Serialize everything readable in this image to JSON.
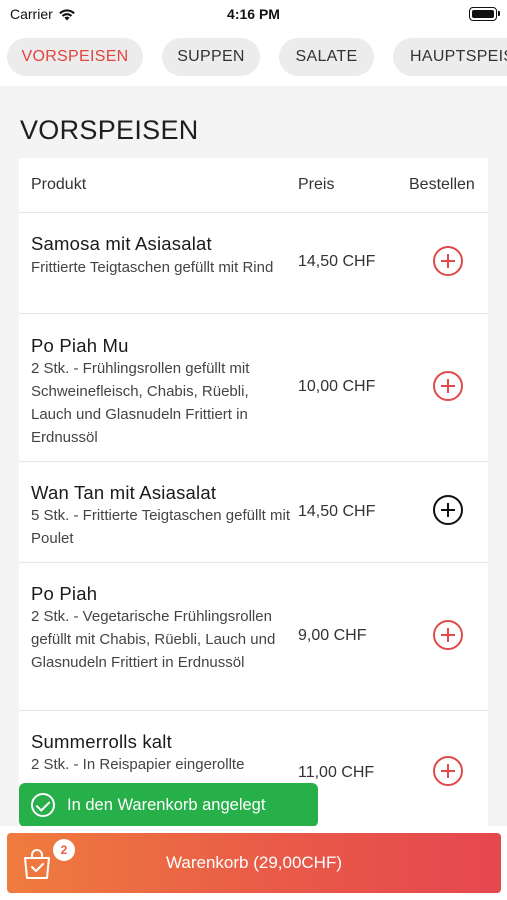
{
  "status_bar": {
    "carrier": "Carrier",
    "time": "4:16 PM"
  },
  "categories": [
    {
      "label": "VORSPEISEN",
      "active": true
    },
    {
      "label": "SUPPEN",
      "active": false
    },
    {
      "label": "SALATE",
      "active": false
    },
    {
      "label": "HAUPTSPEIS",
      "active": false
    }
  ],
  "section": {
    "title": "VORSPEISEN"
  },
  "table": {
    "columns": {
      "product": "Produkt",
      "price": "Preis",
      "order": "Bestellen"
    },
    "rows": [
      {
        "name": "Samosa mit Asiasalat",
        "description": "Frittierte Teigtaschen gefüllt mit Rind",
        "price": "14,50 CHF",
        "in_cart": false
      },
      {
        "name": "Po Piah Mu",
        "description": "2 Stk. - Frühlingsrollen gefüllt mit Schweinefleisch, Chabis, Rüebli, Lauch und Glasnudeln Frittiert in Erdnussöl",
        "price": "10,00 CHF",
        "in_cart": false
      },
      {
        "name": "Wan Tan mit Asiasalat",
        "description": "5 Stk. -  Frittierte Teigtaschen gefüllt mit Poulet",
        "price": "14,50 CHF",
        "in_cart": true
      },
      {
        "name": "Po Piah",
        "description": "2 Stk. - Vegetarische Frühlingsrollen gefüllt mit Chabis, Rüebli, Lauch und Glasnudeln Frittiert in Erdnussöl",
        "price": "9,00 CHF",
        "in_cart": false
      },
      {
        "name": "Summerrolls kalt",
        "description": "2 Stk. - In Reispapier eingerollte",
        "price": "11,00 CHF",
        "in_cart": false
      }
    ]
  },
  "toast": {
    "text": "In den Warenkorb angelegt"
  },
  "cart": {
    "label": "Warenkorb (29,00CHF)",
    "badge": "2"
  },
  "colors": {
    "accent": "#e2443e",
    "toast": "#27b04a",
    "cart_gradient_start": "#ef7c3e",
    "cart_gradient_end": "#e5474f"
  },
  "icons": {
    "wifi": "wifi-icon",
    "battery": "battery-icon",
    "add": "plus-circle-icon",
    "check": "check-circle-icon",
    "cart": "shopping-bag-icon"
  }
}
